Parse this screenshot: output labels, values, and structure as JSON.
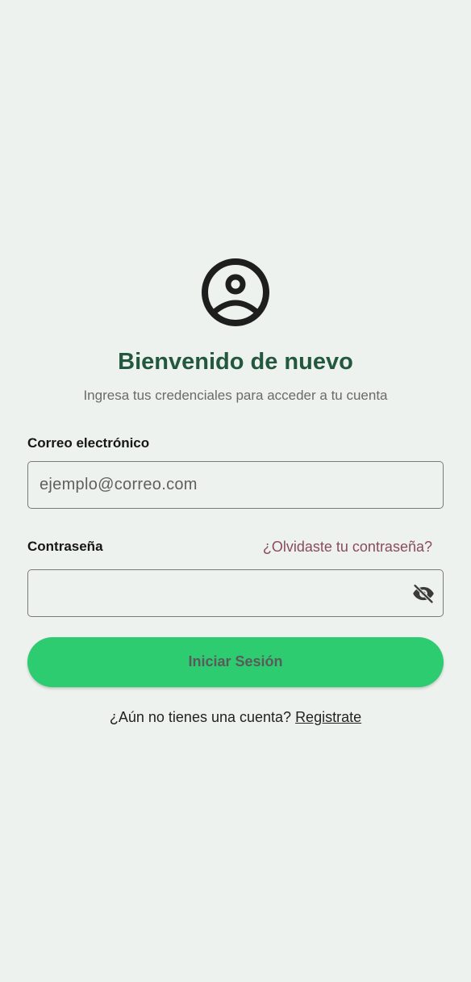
{
  "header": {
    "icon": "account-circle-icon",
    "title": "Bienvenido de nuevo",
    "subtitle": "Ingresa tus credenciales para acceder a tu cuenta"
  },
  "email": {
    "label": "Correo electrónico",
    "placeholder": "ejemplo@correo.com",
    "value": ""
  },
  "password": {
    "label": "Contraseña",
    "forgot_link": "¿Olvidaste tu contraseña?",
    "value": "",
    "toggle_icon": "eye-off-icon"
  },
  "submit_label": "Iniciar Sesión",
  "signup": {
    "prompt": "¿Aún no tienes una cuenta?",
    "link": "Registrate"
  },
  "colors": {
    "background": "#EEF2EE",
    "title": "#23573E",
    "accent_button": "#2ECC71",
    "link": "#8A4A62"
  }
}
